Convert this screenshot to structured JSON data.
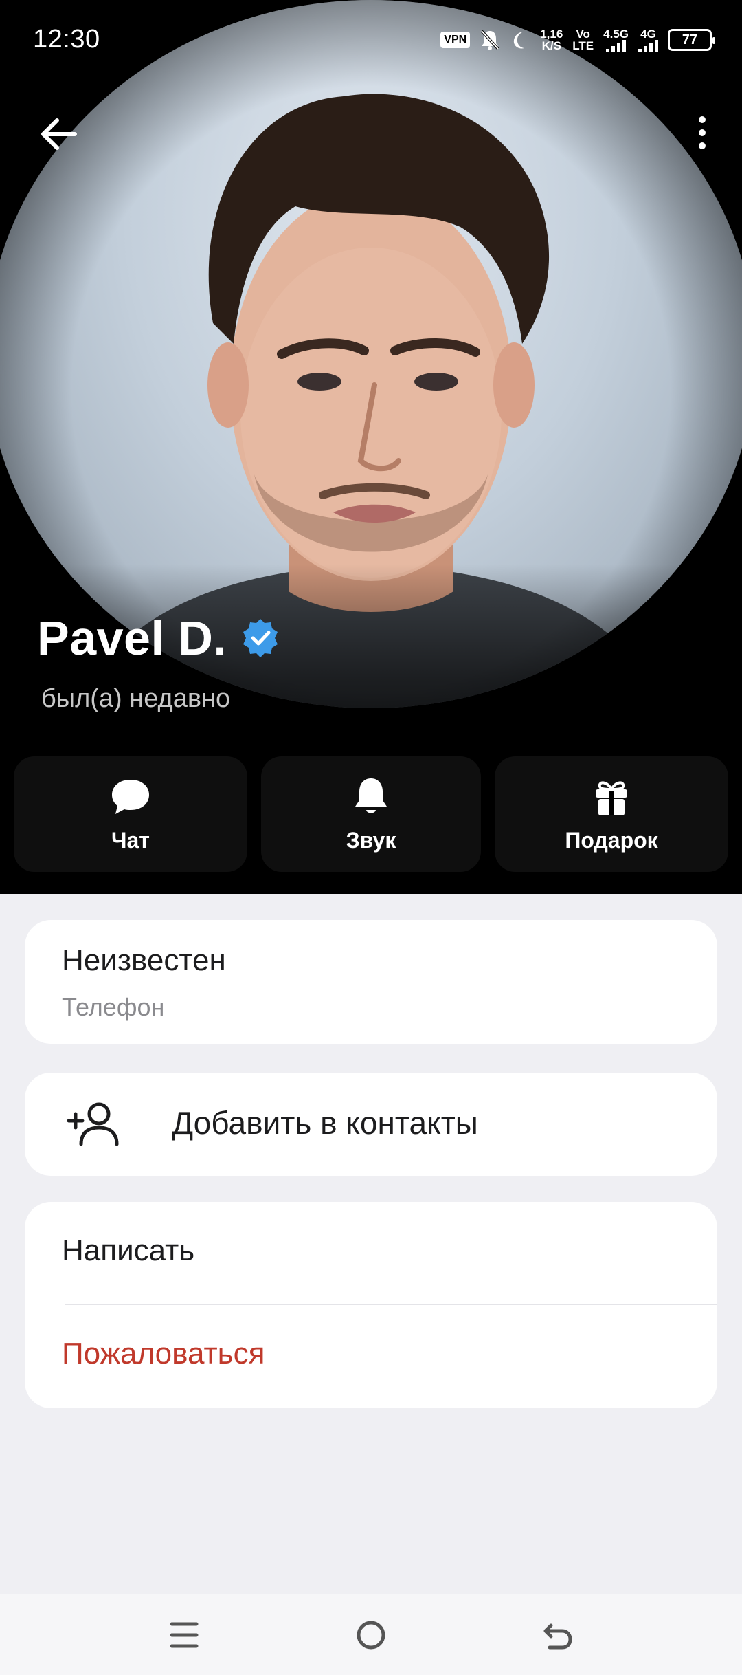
{
  "status_bar": {
    "time": "12:30",
    "vpn": "VPN",
    "speed_value": "1,16",
    "speed_unit": "K/S",
    "volte_top": "Vo",
    "volte_bottom": "LTE",
    "net1": "4.5G",
    "net2": "4G",
    "battery": "77"
  },
  "profile": {
    "name": "Pavel D.",
    "status": "был(а) недавно",
    "verified": true
  },
  "actions": [
    {
      "label": "Чат",
      "icon": "chat-bubble-icon"
    },
    {
      "label": "Звук",
      "icon": "bell-icon"
    },
    {
      "label": "Подарок",
      "icon": "gift-icon"
    }
  ],
  "phone": {
    "value": "Неизвестен",
    "label": "Телефон"
  },
  "add_contact": {
    "label": "Добавить в контакты",
    "icon": "add-person-icon"
  },
  "menu": {
    "write": "Написать",
    "report": "Пожаловаться"
  },
  "colors": {
    "accent_verified": "#3d9be9",
    "danger": "#c0392b",
    "background": "#efeff3"
  },
  "navbar": {
    "icons": [
      "menu-icon",
      "home-icon",
      "back-icon"
    ]
  }
}
